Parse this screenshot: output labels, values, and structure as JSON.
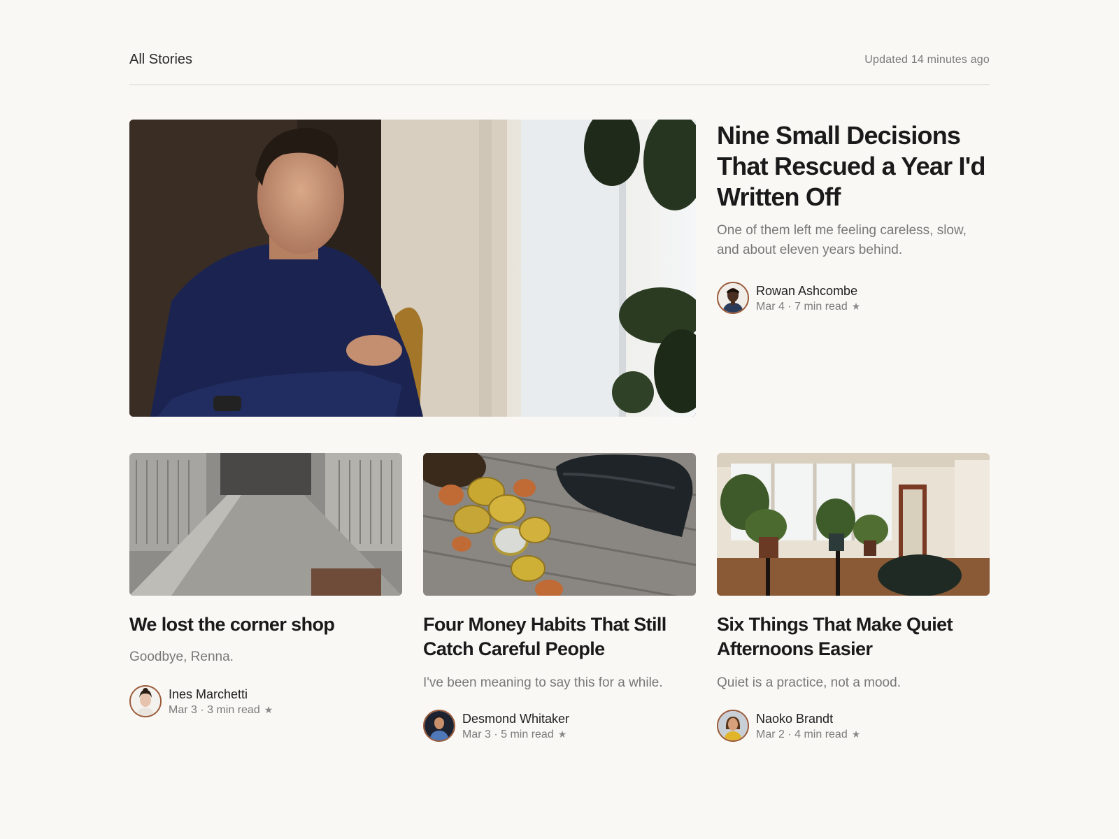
{
  "header": {
    "title": "All Stories",
    "updated": "Updated 14 minutes ago"
  },
  "colors": {
    "background": "#f9f8f5",
    "avatar_ring": "#9b5a3a",
    "muted_text": "#777777"
  },
  "featured": {
    "title": "Nine Small Decisions That Rescued a Year I'd Written Off",
    "subtitle": "One of them left me feeling careless, slow, and about eleven years behind.",
    "author": "Rowan Ashcombe",
    "meta": "Mar 4 · 7 min read",
    "image": "man-by-window-photo"
  },
  "cards": [
    {
      "title": "We lost the corner shop",
      "subtitle": "Goodbye, Renna.",
      "author": "Ines Marchetti",
      "meta": "Mar 3 · 3 min read",
      "image": "shuttered-alley-photo"
    },
    {
      "title": "Four Money Habits That Still Catch Careful People",
      "subtitle": "I've been meaning to say this for a while.",
      "author": "Desmond Whitaker",
      "meta": "Mar 3 · 5 min read",
      "image": "coins-and-wallet-photo"
    },
    {
      "title": "Six Things That Make Quiet Afternoons Easier",
      "subtitle": "Quiet is a practice, not a mood.",
      "author": "Naoko Brandt",
      "meta": "Mar 2 · 4 min read",
      "image": "plant-room-photo"
    }
  ]
}
